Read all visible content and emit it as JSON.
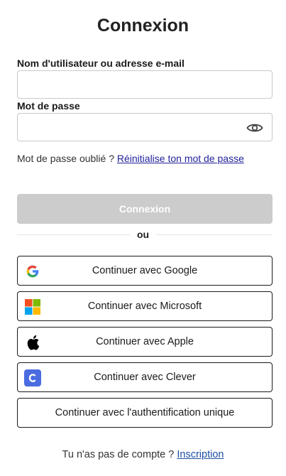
{
  "title": "Connexion",
  "username": {
    "label": "Nom d'utilisateur ou adresse e-mail",
    "value": "",
    "placeholder": ""
  },
  "password": {
    "label": "Mot de passe",
    "value": "",
    "placeholder": "",
    "toggle_icon": "eye-icon"
  },
  "forgot": {
    "text": "Mot de passe oublié ? ",
    "link": "Réinitialise ton mot de passe"
  },
  "submit_label": "Connexion",
  "divider_text": "ou",
  "social": {
    "google": {
      "label": "Continuer avec Google",
      "icon": "google-icon"
    },
    "microsoft": {
      "label": "Continuer avec Microsoft",
      "icon": "microsoft-icon"
    },
    "apple": {
      "label": "Continuer avec Apple",
      "icon": "apple-icon"
    },
    "clever": {
      "label": "Continuer avec Clever",
      "icon": "clever-icon"
    },
    "sso": {
      "label": "Continuer avec l'authentification unique"
    }
  },
  "signup": {
    "text": "Tu n'as pas de compte ? ",
    "link": "Inscription"
  },
  "colors": {
    "submit_disabled_bg": "#cccccc",
    "link": "#1f1f9a",
    "clever_blue": "#4a6ce0"
  }
}
